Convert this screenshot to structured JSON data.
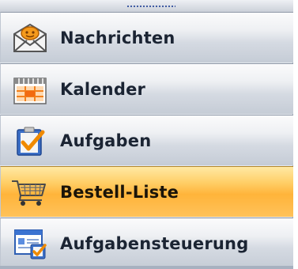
{
  "nav_pane": {
    "items": [
      {
        "label": "Nachrichten",
        "icon": "mail-envelope-icon",
        "selected": false
      },
      {
        "label": "Kalender",
        "icon": "calendar-icon",
        "selected": false
      },
      {
        "label": "Aufgaben",
        "icon": "task-clipboard-icon",
        "selected": false
      },
      {
        "label": "Bestell-Liste",
        "icon": "shopping-cart-icon",
        "selected": true
      },
      {
        "label": "Aufgabensteuerung",
        "icon": "task-control-icon",
        "selected": false
      }
    ]
  },
  "colors": {
    "selected_highlight": "#ffc25a",
    "pane_background": "#e4e8ee",
    "label_text": "#1b2433"
  }
}
